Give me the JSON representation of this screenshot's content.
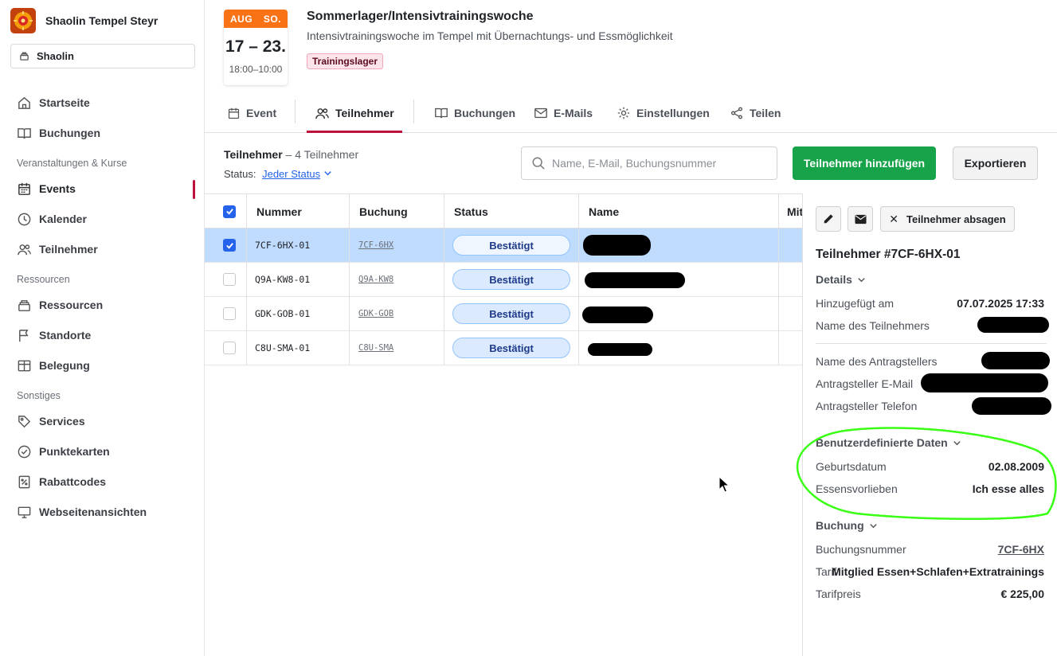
{
  "org": {
    "name": "Shaolin Tempel Steyr",
    "selector": "Shaolin"
  },
  "sidebar": {
    "items": [
      {
        "label": "Startseite",
        "icon": "home-icon"
      },
      {
        "label": "Buchungen",
        "icon": "book-icon"
      },
      {
        "label": "Events",
        "icon": "calendar-icon",
        "active": true
      },
      {
        "label": "Kalender",
        "icon": "clock-icon"
      },
      {
        "label": "Teilnehmer",
        "icon": "users-icon"
      },
      {
        "label": "Ressourcen",
        "icon": "stack-icon"
      },
      {
        "label": "Standorte",
        "icon": "flag-icon"
      },
      {
        "label": "Belegung",
        "icon": "columns-icon"
      },
      {
        "label": "Services",
        "icon": "tag-icon"
      },
      {
        "label": "Punktekarten",
        "icon": "check-circle-icon"
      },
      {
        "label": "Rabattcodes",
        "icon": "percent-icon"
      },
      {
        "label": "Webseitenansichten",
        "icon": "monitor-icon"
      }
    ],
    "sections": [
      "Veranstaltungen & Kurse",
      "Ressourcen",
      "Sonstiges"
    ]
  },
  "event": {
    "month": "AUG",
    "weekday": "SO.",
    "range": "17 – 23.",
    "time": "18:00–10:00",
    "title": "Sommerlager/Intensivtrainingswoche",
    "subtitle": "Intensivtrainingswoche im Tempel mit Übernachtungs- und Essmöglichkeit",
    "tag": "Trainingslager"
  },
  "tabs": [
    "Event",
    "Teilnehmer",
    "Buchungen",
    "E-Mails",
    "Einstellungen",
    "Teilen"
  ],
  "active_tab": "Teilnehmer",
  "toolbar": {
    "title": "Teilnehmer",
    "count": "– 4 Teilnehmer",
    "status_label": "Status:",
    "status_value": "Jeder Status",
    "search_placeholder": "Name, E-Mail, Buchungsnummer",
    "add_label": "Teilnehmer hinzufügen",
    "export_label": "Exportieren"
  },
  "table": {
    "columns": [
      "Nummer",
      "Buchung",
      "Status",
      "Name",
      "Mit"
    ],
    "rows": [
      {
        "nummer": "7CF-6HX-01",
        "buchung": "7CF-6HX",
        "status": "Bestätigt",
        "selected": true
      },
      {
        "nummer": "Q9A-KW8-01",
        "buchung": "Q9A-KW8",
        "status": "Bestätigt",
        "selected": false
      },
      {
        "nummer": "GDK-GOB-01",
        "buchung": "GDK-GOB",
        "status": "Bestätigt",
        "selected": false
      },
      {
        "nummer": "C8U-SMA-01",
        "buchung": "C8U-SMA",
        "status": "Bestätigt",
        "selected": false
      }
    ]
  },
  "panel": {
    "cancel_label": "Teilnehmer absagen",
    "title": "Teilnehmer #7CF-6HX-01",
    "details_section": "Details",
    "added_label": "Hinzugefügt am",
    "added_value": "07.07.2025 17:33",
    "participant_name_label": "Name des Teilnehmers",
    "applicant_name_label": "Name des Antragstellers",
    "applicant_email_label": "Antragsteller E-Mail",
    "applicant_phone_label": "Antragsteller Telefon",
    "custom_section": "Benutzerdefinierte Daten",
    "birthdate_label": "Geburtsdatum",
    "birthdate_value": "02.08.2009",
    "food_label": "Essensvorlieben",
    "food_value": "Ich esse alles",
    "booking_section": "Buchung",
    "booking_no_label": "Buchungsnummer",
    "booking_no_value": "7CF-6HX",
    "tariff_label": "Tarif",
    "tariff_value": "Mitglied Essen+Schlafen+Extratrainings",
    "price_label": "Tarifpreis",
    "price_value": "€ 225,00"
  },
  "colors": {
    "accent": "#be123c",
    "primary_button": "#16a34a",
    "date_header": "#f97316",
    "selected_row": "#bfdbfe",
    "annotation": "#39ff14"
  }
}
